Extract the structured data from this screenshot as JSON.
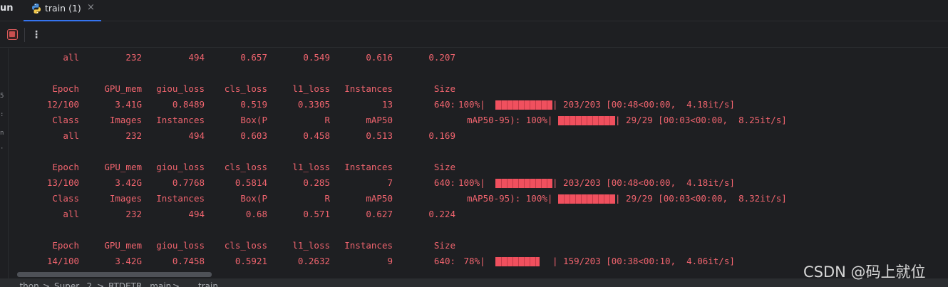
{
  "tabbar": {
    "run_label": "un",
    "tab": {
      "label": "train (1)",
      "icon": "python-icon",
      "close": "×"
    }
  },
  "toolbar": {
    "stop_icon": "stop-icon",
    "more_icon": "⋮"
  },
  "gutter": {
    "marks": [
      "5",
      ":",
      "n",
      "·"
    ]
  },
  "colors": {
    "output": "#f0646e",
    "progress_fill": "#f0505e",
    "background": "#1e1f22"
  },
  "console": {
    "rows": [
      {
        "kind": "val",
        "cols": [
          "all",
          "232",
          "494",
          "0.657",
          "0.549",
          "0.616",
          "0.207"
        ]
      },
      {
        "kind": "blank"
      },
      {
        "kind": "train_head",
        "cols": [
          "Epoch",
          "GPU_mem",
          "giou_loss",
          "cls_loss",
          "l1_loss",
          "Instances",
          "Size"
        ]
      },
      {
        "kind": "train",
        "cols": [
          "12/100",
          "3.41G",
          "0.8489",
          "0.519",
          "0.3305",
          "13",
          "640:"
        ],
        "pct": "100%|",
        "fill": 1.0,
        "blocks": 10,
        "tail": "| 203/203 [00:48<00:00,  4.18it/s]"
      },
      {
        "kind": "val_head",
        "cols": [
          "Class",
          "Images",
          "Instances",
          "Box(P",
          "R",
          "mAP50",
          "mAP50-95): 100%|"
        ],
        "fill": 1.0,
        "blocks": 10,
        "tail": "| 29/29 [00:03<00:00,  8.25it/s]"
      },
      {
        "kind": "val",
        "cols": [
          "all",
          "232",
          "494",
          "0.603",
          "0.458",
          "0.513",
          "0.169"
        ]
      },
      {
        "kind": "blank"
      },
      {
        "kind": "train_head",
        "cols": [
          "Epoch",
          "GPU_mem",
          "giou_loss",
          "cls_loss",
          "l1_loss",
          "Instances",
          "Size"
        ]
      },
      {
        "kind": "train",
        "cols": [
          "13/100",
          "3.42G",
          "0.7768",
          "0.5814",
          "0.285",
          "7",
          "640:"
        ],
        "pct": "100%|",
        "fill": 1.0,
        "blocks": 10,
        "tail": "| 203/203 [00:48<00:00,  4.18it/s]"
      },
      {
        "kind": "val_head",
        "cols": [
          "Class",
          "Images",
          "Instances",
          "Box(P",
          "R",
          "mAP50",
          "mAP50-95): 100%|"
        ],
        "fill": 1.0,
        "blocks": 10,
        "tail": "| 29/29 [00:03<00:00,  8.32it/s]"
      },
      {
        "kind": "val",
        "cols": [
          "all",
          "232",
          "494",
          "0.68",
          "0.571",
          "0.627",
          "0.224"
        ]
      },
      {
        "kind": "blank"
      },
      {
        "kind": "train_head",
        "cols": [
          "Epoch",
          "GPU_mem",
          "giou_loss",
          "cls_loss",
          "l1_loss",
          "Instances",
          "Size"
        ]
      },
      {
        "kind": "train",
        "cols": [
          "14/100",
          "3.42G",
          "0.7458",
          "0.5921",
          "0.2632",
          "9",
          "640:"
        ],
        "pct": " 78%|",
        "fill": 0.78,
        "blocks": 8,
        "tail": "| 159/203 [00:38<00:10,  4.06it/s]"
      }
    ]
  },
  "breadcrumb": [
    "...thon",
    ">",
    "Super...2",
    ">",
    "RTDETR...main",
    ">",
    "train"
  ],
  "watermark": "CSDN @码上就位"
}
